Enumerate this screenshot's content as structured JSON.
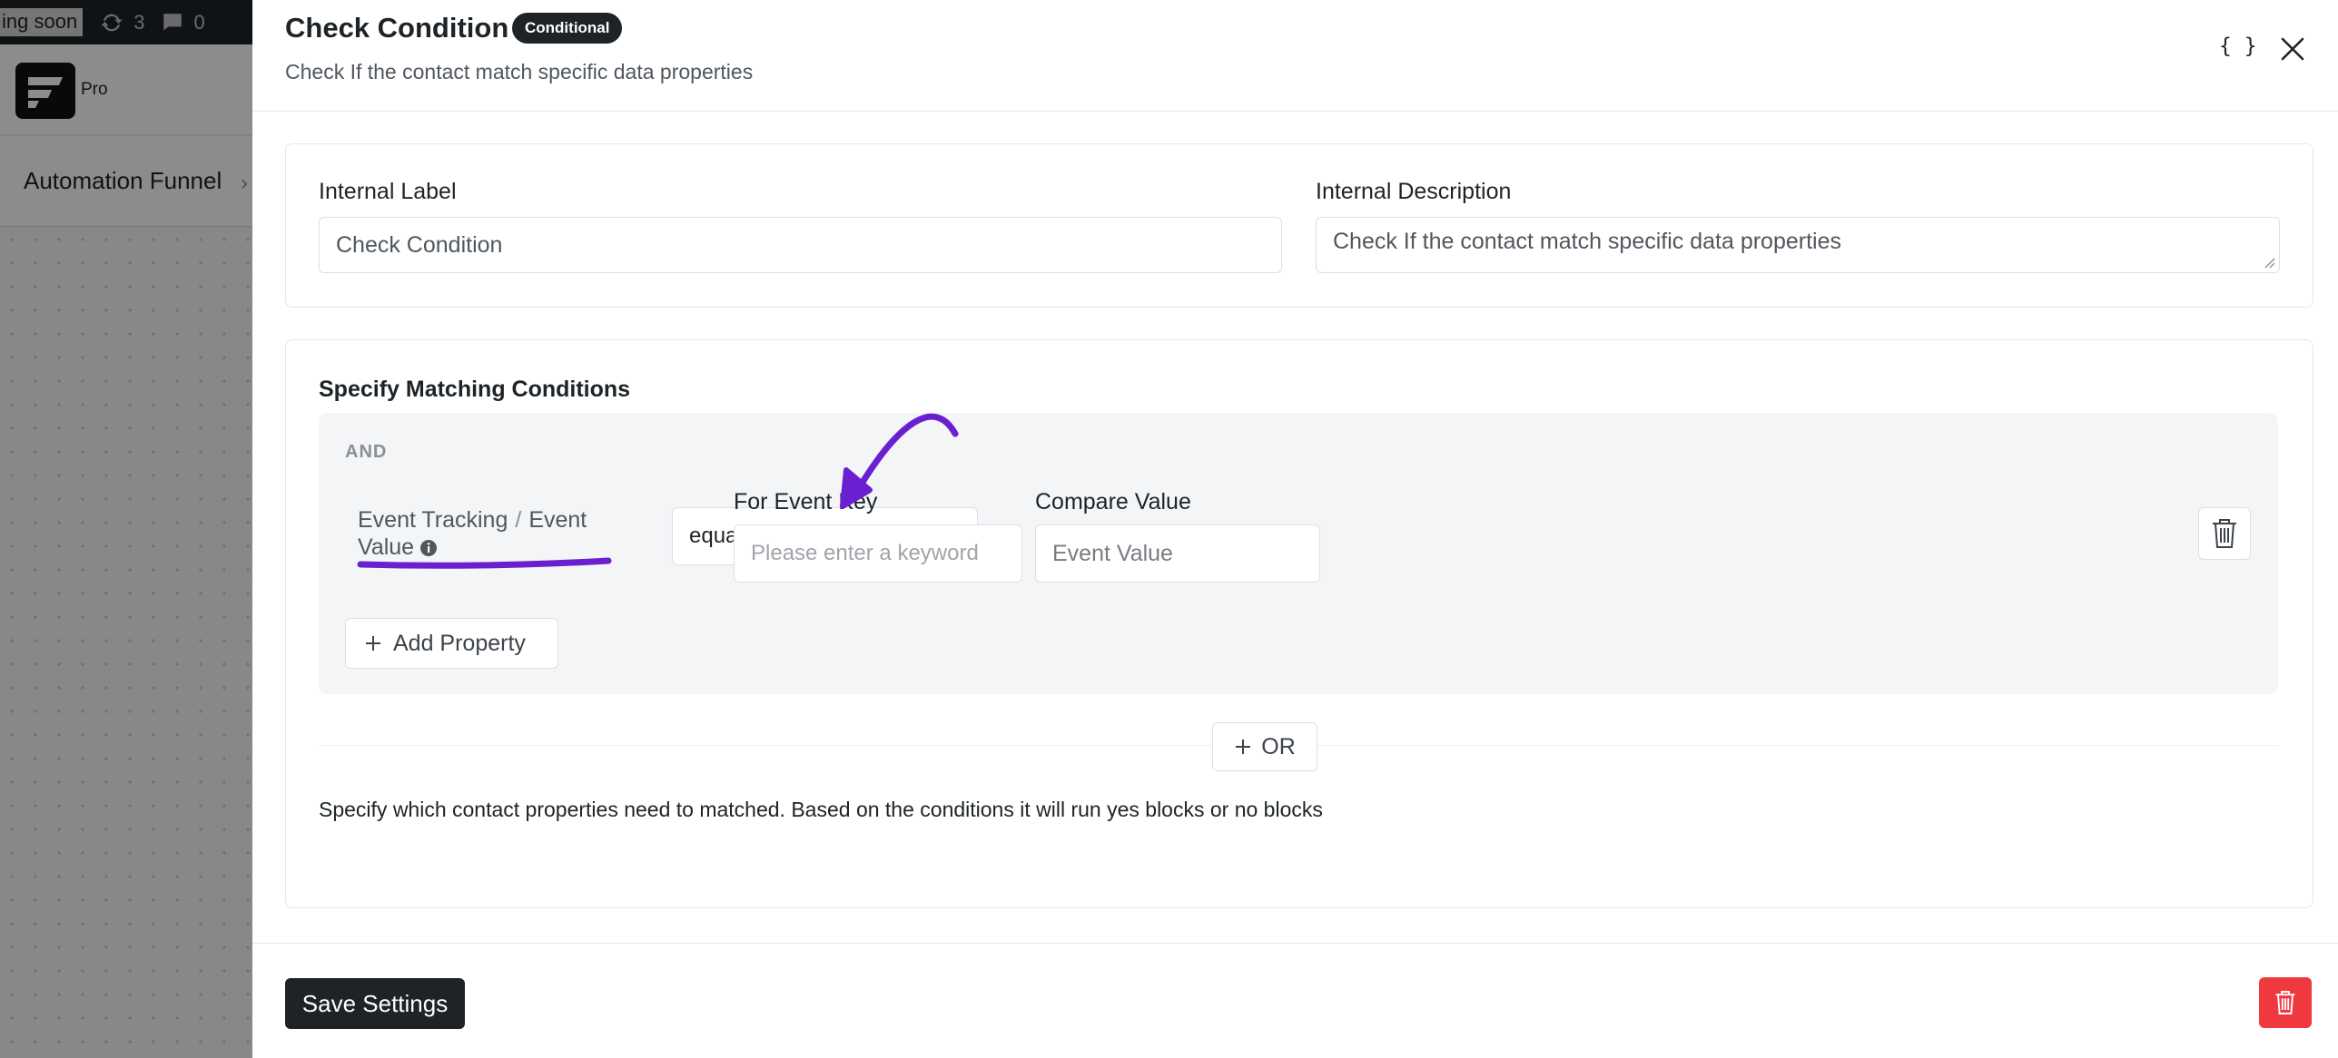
{
  "admin_bar": {
    "coming_soon": "ing soon",
    "updates_count": "3",
    "comments_count": "0"
  },
  "app_bar": {
    "plan_label": "Pro"
  },
  "sub_bar": {
    "breadcrumb": "Automation Funnel"
  },
  "drawer": {
    "title": "Check Condition",
    "badge": "Conditional",
    "subtitle": "Check If the contact match specific data properties",
    "code_toggle": "{ }"
  },
  "meta": {
    "label_title": "Internal Label",
    "label_value": "Check Condition",
    "description_title": "Internal Description",
    "description_value": "Check If the contact match specific data properties"
  },
  "conditions": {
    "title": "Specify Matching Conditions",
    "group_operator": "AND",
    "rule": {
      "property_group": "Event Tracking",
      "separator": "/",
      "property_name": "Event Value",
      "operator": "equal",
      "event_key_label": "For Event Key",
      "event_key_placeholder": "Please enter a keyword",
      "compare_label": "Compare Value",
      "compare_placeholder": "Event Value"
    },
    "add_property": "Add Property",
    "or_button": "OR",
    "help": "Specify which contact properties need to matched. Based on the conditions it will run yes blocks or no blocks"
  },
  "footer": {
    "save": "Save Settings"
  },
  "colors": {
    "dark": "#1d2327",
    "danger": "#f0383f",
    "annotation": "#6a1fd1"
  }
}
